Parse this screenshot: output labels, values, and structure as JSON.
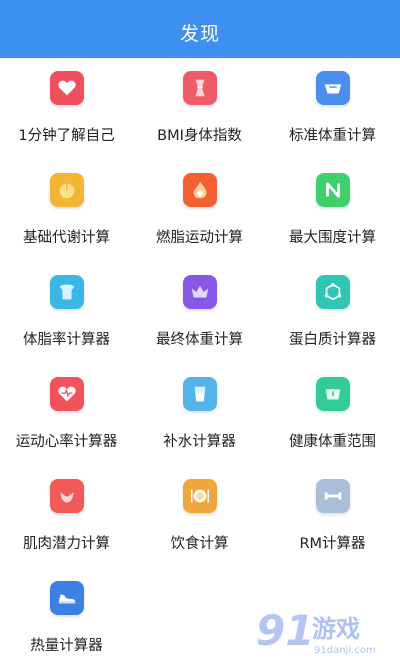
{
  "header": {
    "title": "发现"
  },
  "tools": [
    {
      "label": "1分钟了解自己",
      "icon": "heart-icon",
      "color": "#f04f5d"
    },
    {
      "label": "BMI身体指数",
      "icon": "body-figure-icon",
      "color": "#ef5b66"
    },
    {
      "label": "标准体重计算",
      "icon": "scale-icon",
      "color": "#4a8ef0"
    },
    {
      "label": "基础代谢计算",
      "icon": "peach-icon",
      "color": "#f3b634"
    },
    {
      "label": "燃脂运动计算",
      "icon": "flame-icon",
      "color": "#f2612f"
    },
    {
      "label": "最大围度计算",
      "icon": "letter-n-icon",
      "color": "#3fd06d"
    },
    {
      "label": "体脂率计算器",
      "icon": "torso-icon",
      "color": "#3bb7e6"
    },
    {
      "label": "最终体重计算",
      "icon": "crown-icon",
      "color": "#8757e5"
    },
    {
      "label": "蛋白质计算器",
      "icon": "molecule-icon",
      "color": "#2fc7b4"
    },
    {
      "label": "运动心率计算器",
      "icon": "heart-rate-icon",
      "color": "#f0535b"
    },
    {
      "label": "补水计算器",
      "icon": "water-cup-icon",
      "color": "#52b4ea"
    },
    {
      "label": "健康体重范围",
      "icon": "range-scale-icon",
      "color": "#33cc99"
    },
    {
      "label": "肌肉潜力计算",
      "icon": "muscle-arm-icon",
      "color": "#f25a5a"
    },
    {
      "label": "饮食计算",
      "icon": "dish-icon",
      "color": "#f0a63a"
    },
    {
      "label": "RM计算器",
      "icon": "dumbbell-icon",
      "color": "#a9bfd9"
    },
    {
      "label": "热量计算器",
      "icon": "running-shoe-icon",
      "color": "#3c80e3"
    }
  ],
  "watermark": {
    "number": "91",
    "brand": "游戏",
    "domain": "91danji.com"
  }
}
